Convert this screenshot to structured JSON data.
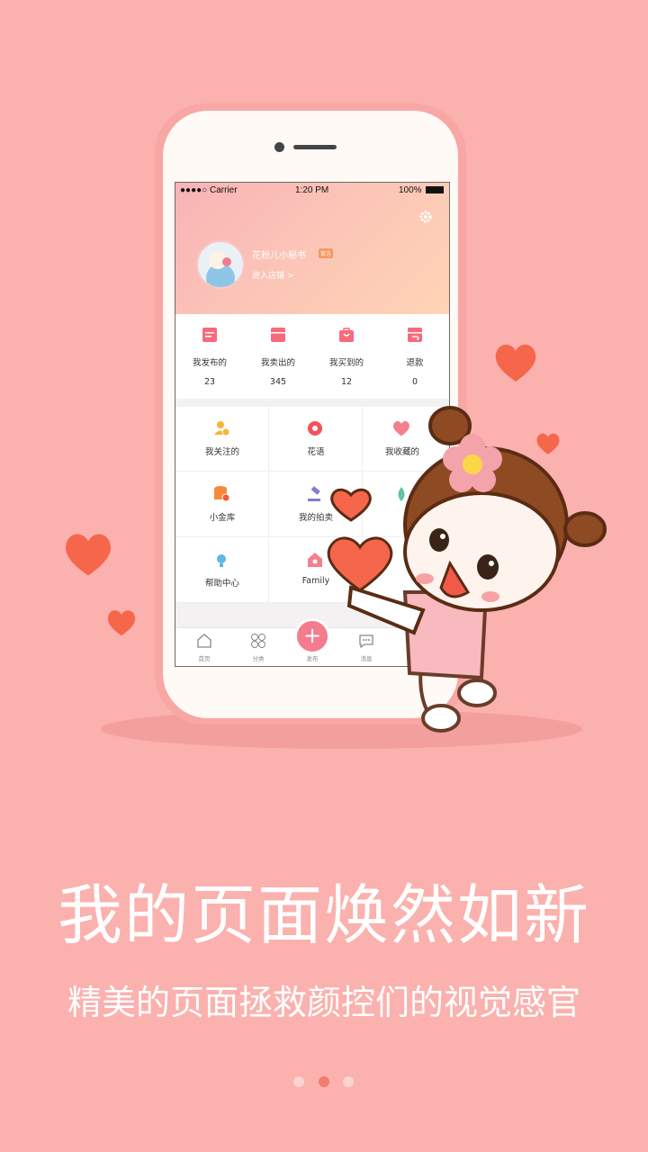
{
  "status_bar": {
    "carrier": "●●●●○ Carrier",
    "time": "1:20 PM",
    "battery": "100%"
  },
  "profile": {
    "name": "花粉儿小秘书",
    "badge": "官方",
    "enter_shop": "进入店铺 >"
  },
  "stats": [
    {
      "label": "我发布的",
      "count": "23",
      "icon": "publish-icon"
    },
    {
      "label": "我卖出的",
      "count": "345",
      "icon": "sold-icon"
    },
    {
      "label": "我买到的",
      "count": "12",
      "icon": "bought-icon"
    },
    {
      "label": "退款",
      "count": "0",
      "icon": "refund-icon"
    }
  ],
  "menu": [
    {
      "label": "我关注的",
      "icon": "follow-icon"
    },
    {
      "label": "花语",
      "icon": "flower-icon"
    },
    {
      "label": "我收藏的",
      "icon": "favorite-icon"
    },
    {
      "label": "小金库",
      "icon": "coins-icon"
    },
    {
      "label": "我的拍卖",
      "icon": "auction-icon"
    },
    {
      "label": "",
      "icon": "drop-icon"
    },
    {
      "label": "帮助中心",
      "icon": "help-icon"
    },
    {
      "label": "Family",
      "icon": "family-icon"
    },
    {
      "label": "",
      "icon": ""
    }
  ],
  "tabs": [
    {
      "label": "首页",
      "icon": "home-icon"
    },
    {
      "label": "分类",
      "icon": "category-icon"
    },
    {
      "label": "发布",
      "icon": "plus-icon"
    },
    {
      "label": "消息",
      "icon": "message-icon"
    }
  ],
  "fab_symbol": "+",
  "headline": "我的页面焕然如新",
  "subheadline": "精美的页面拯救颜控们的视觉感官",
  "pagination": {
    "total": 3,
    "active": 2
  },
  "colors": {
    "background": "#fbb1ae",
    "accent": "#f47c8e",
    "dot_active": "#f47b70",
    "dot_inactive": "#fbd3d0"
  }
}
